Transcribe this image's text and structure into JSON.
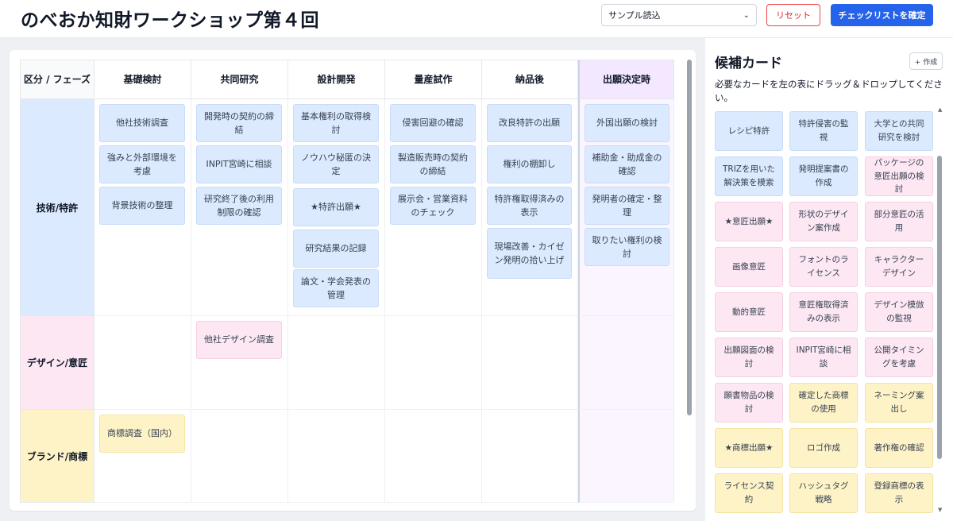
{
  "header": {
    "title": "のべおか知財ワークショップ第４回",
    "sample_select_value": "サンプル読込",
    "reset_label": "リセット",
    "confirm_label": "チェックリストを確定"
  },
  "board": {
    "corner_label": "区分 / フェーズ",
    "phases": [
      "基礎検討",
      "共同研究",
      "設計開発",
      "量産試作",
      "納品後",
      "出願決定時"
    ],
    "rows": [
      {
        "label": "技術/特許",
        "kind": "tech",
        "cells": [
          [
            "他社技術調査",
            "強みと外部環境を考慮",
            "背景技術の整理"
          ],
          [
            "開発時の契約の締結",
            "INPIT宮崎に相談",
            "研究終了後の利用制限の確認"
          ],
          [
            "基本権利の取得検討",
            "ノウハウ秘匿の決定",
            "★特許出願★",
            "研究結果の記録",
            "論文・学会発表の管理"
          ],
          [
            "侵害回避の確認",
            "製造販売時の契約の締結",
            "展示会・営業資料のチェック"
          ],
          [
            "改良特許の出願",
            "権利の棚卸し",
            "特許権取得済みの表示",
            "現場改善・カイゼン発明の拾い上げ"
          ],
          [
            "外国出願の検討",
            "補助金・助成金の確認",
            "発明者の確定・整理",
            "取りたい権利の検討"
          ]
        ]
      },
      {
        "label": "デザイン/意匠",
        "kind": "design",
        "cells": [
          [],
          [
            "他社デザイン調査"
          ],
          [],
          [],
          [],
          []
        ]
      },
      {
        "label": "ブランド/商標",
        "kind": "brand",
        "cells": [
          [
            "商標調査（国内）"
          ],
          [],
          [],
          [],
          [],
          []
        ]
      }
    ]
  },
  "candidates": {
    "title": "候補カード",
    "create_label": "+ 作成",
    "description": "必要なカードを左の表にドラッグ＆ドロップしてください。",
    "cards": [
      {
        "text": "レシピ特許",
        "kind": "tech"
      },
      {
        "text": "特許侵害の監視",
        "kind": "tech"
      },
      {
        "text": "大学との共同研究を検討",
        "kind": "tech"
      },
      {
        "text": "TRIZを用いた解決策を模索",
        "kind": "tech"
      },
      {
        "text": "発明提案書の作成",
        "kind": "tech"
      },
      {
        "text": "パッケージの意匠出願の検討",
        "kind": "design"
      },
      {
        "text": "★意匠出願★",
        "kind": "design"
      },
      {
        "text": "形状のデザイン案作成",
        "kind": "design"
      },
      {
        "text": "部分意匠の活用",
        "kind": "design"
      },
      {
        "text": "画像意匠",
        "kind": "design"
      },
      {
        "text": "フォントのライセンス",
        "kind": "design"
      },
      {
        "text": "キャラクターデザイン",
        "kind": "design"
      },
      {
        "text": "動的意匠",
        "kind": "design"
      },
      {
        "text": "意匠権取得済みの表示",
        "kind": "design"
      },
      {
        "text": "デザイン模倣の監視",
        "kind": "design"
      },
      {
        "text": "出願図面の検討",
        "kind": "design"
      },
      {
        "text": "INPIT宮崎に相談",
        "kind": "design"
      },
      {
        "text": "公開タイミングを考慮",
        "kind": "design"
      },
      {
        "text": "願書物品の検討",
        "kind": "design"
      },
      {
        "text": "確定した商標の使用",
        "kind": "brand"
      },
      {
        "text": "ネーミング案出し",
        "kind": "brand"
      },
      {
        "text": "★商標出願★",
        "kind": "brand"
      },
      {
        "text": "ロゴ作成",
        "kind": "brand"
      },
      {
        "text": "著作権の確認",
        "kind": "brand"
      },
      {
        "text": "ライセンス契約",
        "kind": "brand"
      },
      {
        "text": "ハッシュタグ戦略",
        "kind": "brand"
      },
      {
        "text": "登録商標の表示",
        "kind": "brand"
      }
    ]
  },
  "icons": {
    "select_chevron": "chevron-down-icon",
    "scroll_up": "arrow-up-icon",
    "scroll_down": "arrow-down-icon"
  },
  "colors": {
    "accent": "#2563eb",
    "reset": "#dc2626",
    "tech": "#dbeafe",
    "design": "#fce7f3",
    "brand": "#fef3c7",
    "final_phase": "#f3e8ff"
  }
}
